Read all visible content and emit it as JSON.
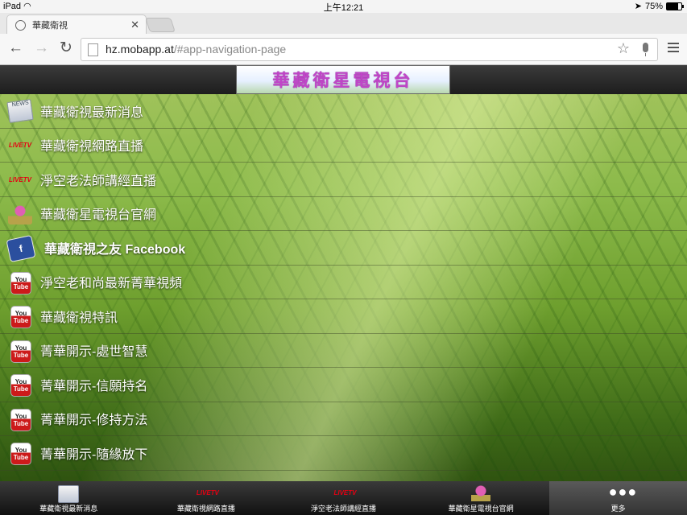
{
  "status_bar": {
    "device": "iPad",
    "time": "上午12:21",
    "battery": "75%",
    "battery_level": 0.75
  },
  "browser": {
    "tab_title": "華藏衛視",
    "url_host": "hz.mobapp.at",
    "url_path": "/#app-navigation-page"
  },
  "app": {
    "banner_text": "華藏衛星電視台",
    "menu_items": [
      {
        "label": "華藏衛視最新消息",
        "icon": "news-icon"
      },
      {
        "label": "華藏衛視網路直播",
        "icon": "live-tv-icon"
      },
      {
        "label": "淨空老法師講經直播",
        "icon": "live-tv-icon"
      },
      {
        "label": "華藏衛星電視台官網",
        "icon": "lotus-logo-icon"
      },
      {
        "label": "華藏衛視之友 Facebook",
        "icon": "facebook-icon"
      },
      {
        "label": "淨空老和尚最新菁華視頻",
        "icon": "youtube-icon"
      },
      {
        "label": "華藏衛視特訊",
        "icon": "youtube-icon"
      },
      {
        "label": "菁華開示-處世智慧",
        "icon": "youtube-icon"
      },
      {
        "label": "菁華開示-信願持名",
        "icon": "youtube-icon"
      },
      {
        "label": "菁華開示-修持方法",
        "icon": "youtube-icon"
      },
      {
        "label": "菁華開示-隨緣放下",
        "icon": "youtube-icon"
      }
    ],
    "tab_bar": [
      {
        "label": "華藏衛視最新消息",
        "icon": "news-icon"
      },
      {
        "label": "華藏衛視網路直播",
        "icon": "live-tv-icon"
      },
      {
        "label": "淨空老法師講經直播",
        "icon": "live-tv-icon"
      },
      {
        "label": "華藏衛星電視台官網",
        "icon": "lotus-logo-icon"
      },
      {
        "label": "更多",
        "icon": "more-icon"
      }
    ],
    "live_badge_text": "LIVETV",
    "youtube_badge": {
      "top": "You",
      "bottom": "Tube"
    },
    "facebook_badge": "f",
    "news_badge": "NEWS"
  },
  "colors": {
    "header_bg": "#2a2a2a",
    "banner_text": "#c045c8",
    "live_red": "#e60012",
    "youtube_red": "#cc1a1a",
    "facebook_blue": "#2b4f9e"
  }
}
